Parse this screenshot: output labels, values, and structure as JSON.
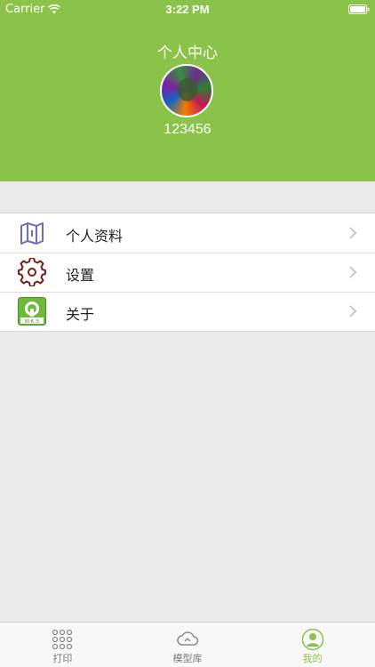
{
  "status_bar": {
    "carrier": "Carrier",
    "time": "3:22 PM"
  },
  "header": {
    "title": "个人中心",
    "username": "123456",
    "background_color": "#8bc34a"
  },
  "menu": {
    "items": [
      {
        "label": "个人资料",
        "icon": "map-icon"
      },
      {
        "label": "设置",
        "icon": "gear-icon"
      },
      {
        "label": "关于",
        "icon": "mks-logo-icon",
        "logo_text": "M K S"
      }
    ]
  },
  "tabbar": {
    "tabs": [
      {
        "label": "打印",
        "icon": "grid-dots-icon",
        "active": false
      },
      {
        "label": "模型库",
        "icon": "cloud-icon",
        "active": false
      },
      {
        "label": "我的",
        "icon": "person-icon",
        "active": true
      }
    ],
    "active_color": "#8bc34a",
    "inactive_color": "#7a7a7a"
  }
}
